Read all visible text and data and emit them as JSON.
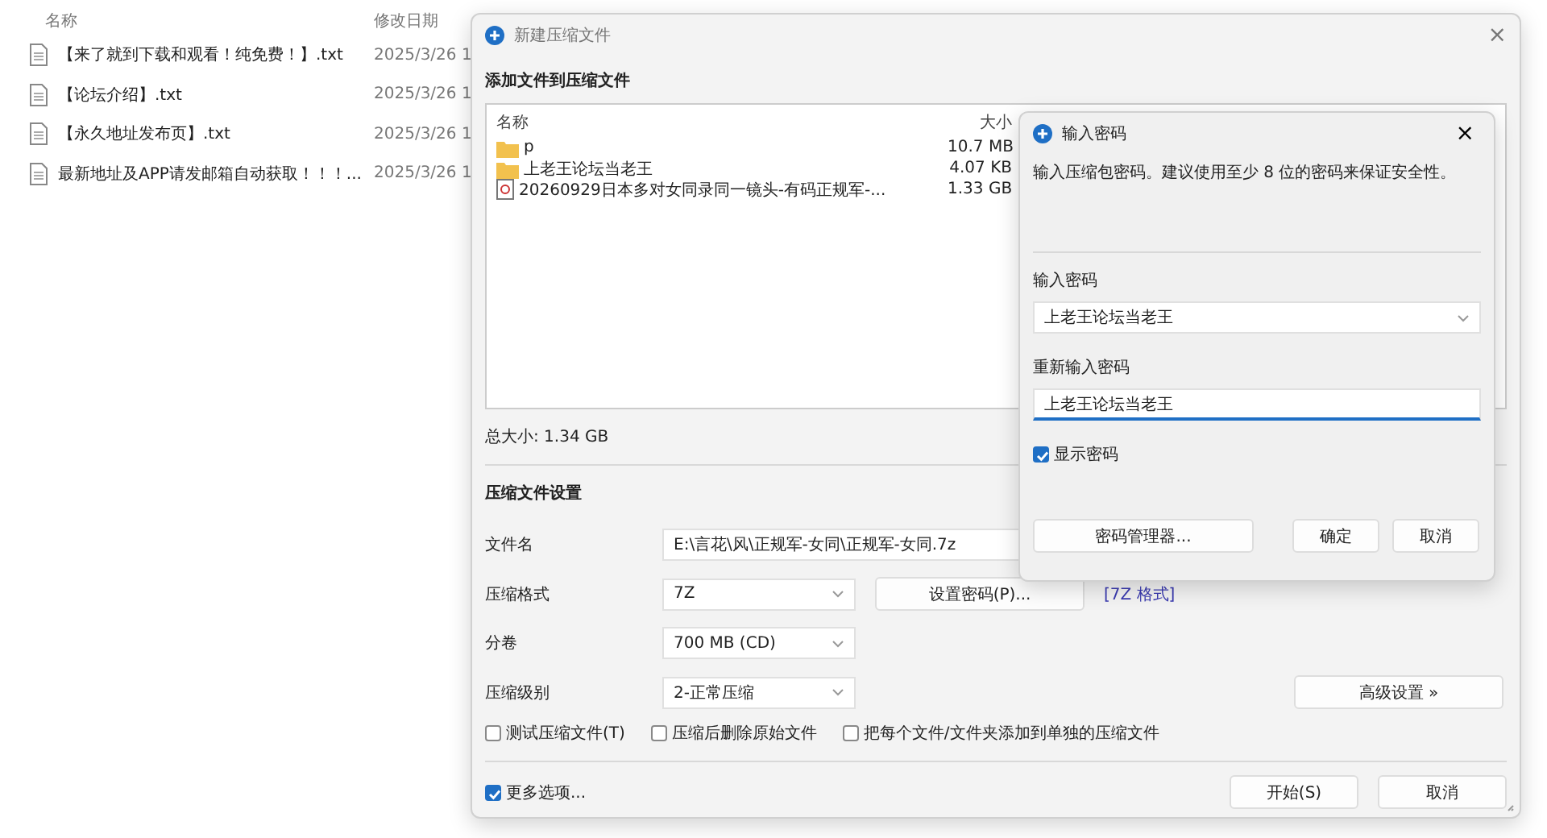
{
  "explorer": {
    "columns": [
      "名称",
      "修改日期"
    ],
    "rows": [
      {
        "name": "【来了就到下载和观看！纯免费！】.txt",
        "date": "2025/3/26 1"
      },
      {
        "name": "【论坛介绍】.txt",
        "date": "2025/3/26 1"
      },
      {
        "name": "【永久地址发布页】.txt",
        "date": "2025/3/26 1"
      },
      {
        "name": "最新地址及APP请发邮箱自动获取！！！...",
        "date": "2025/3/26 1"
      }
    ]
  },
  "archive_dialog": {
    "title": "新建压缩文件",
    "files_heading": "添加文件到压缩文件",
    "file_columns": [
      "名称",
      "大小"
    ],
    "files": [
      {
        "kind": "folder",
        "name": "p",
        "size": "10.7 MB"
      },
      {
        "kind": "folder",
        "name": "上老王论坛当老王",
        "size": "4.07 KB"
      },
      {
        "kind": "file",
        "name": "20260929日本多对女同录同一镜头-有码正规军-...",
        "size": "1.33 GB"
      }
    ],
    "total": "总大小: 1.34 GB",
    "settings_heading": "压缩文件设置",
    "filename_label": "文件名",
    "filename": "E:\\言花\\风\\正规军-女同\\正规军-女同.7z",
    "format_label": "压缩格式",
    "format": "7Z",
    "set_password": "设置密码(P)...",
    "format_link": "[7Z 格式]",
    "volume_label": "分卷",
    "volume": "700 MB (CD)",
    "level_label": "压缩级别",
    "level_value": "2-正常压缩",
    "advanced": "高级设置 »",
    "options": [
      {
        "label": "测试压缩文件(T)",
        "checked": false
      },
      {
        "label": "压缩后删除原始文件",
        "checked": false
      },
      {
        "label": "把每个文件/文件夹添加到单独的压缩文件",
        "checked": false
      }
    ],
    "more_options": {
      "label": "更多选项...",
      "checked": true
    },
    "buttons": [
      "开始(S)",
      "取消"
    ]
  },
  "password_dialog": {
    "title": "输入密码",
    "close": "×",
    "description": "输入压缩包密码。建议使用至少 8 位的密码来保证安全性。",
    "password_label": "输入密码",
    "password": "上老王论坛当老王",
    "repeat_label": "重新输入密码",
    "repeat": "上老王论坛当老王",
    "show_password": {
      "label": "显示密码",
      "checked": true
    },
    "manager": "密码管理器...",
    "buttons": [
      "确定",
      "取消"
    ]
  }
}
